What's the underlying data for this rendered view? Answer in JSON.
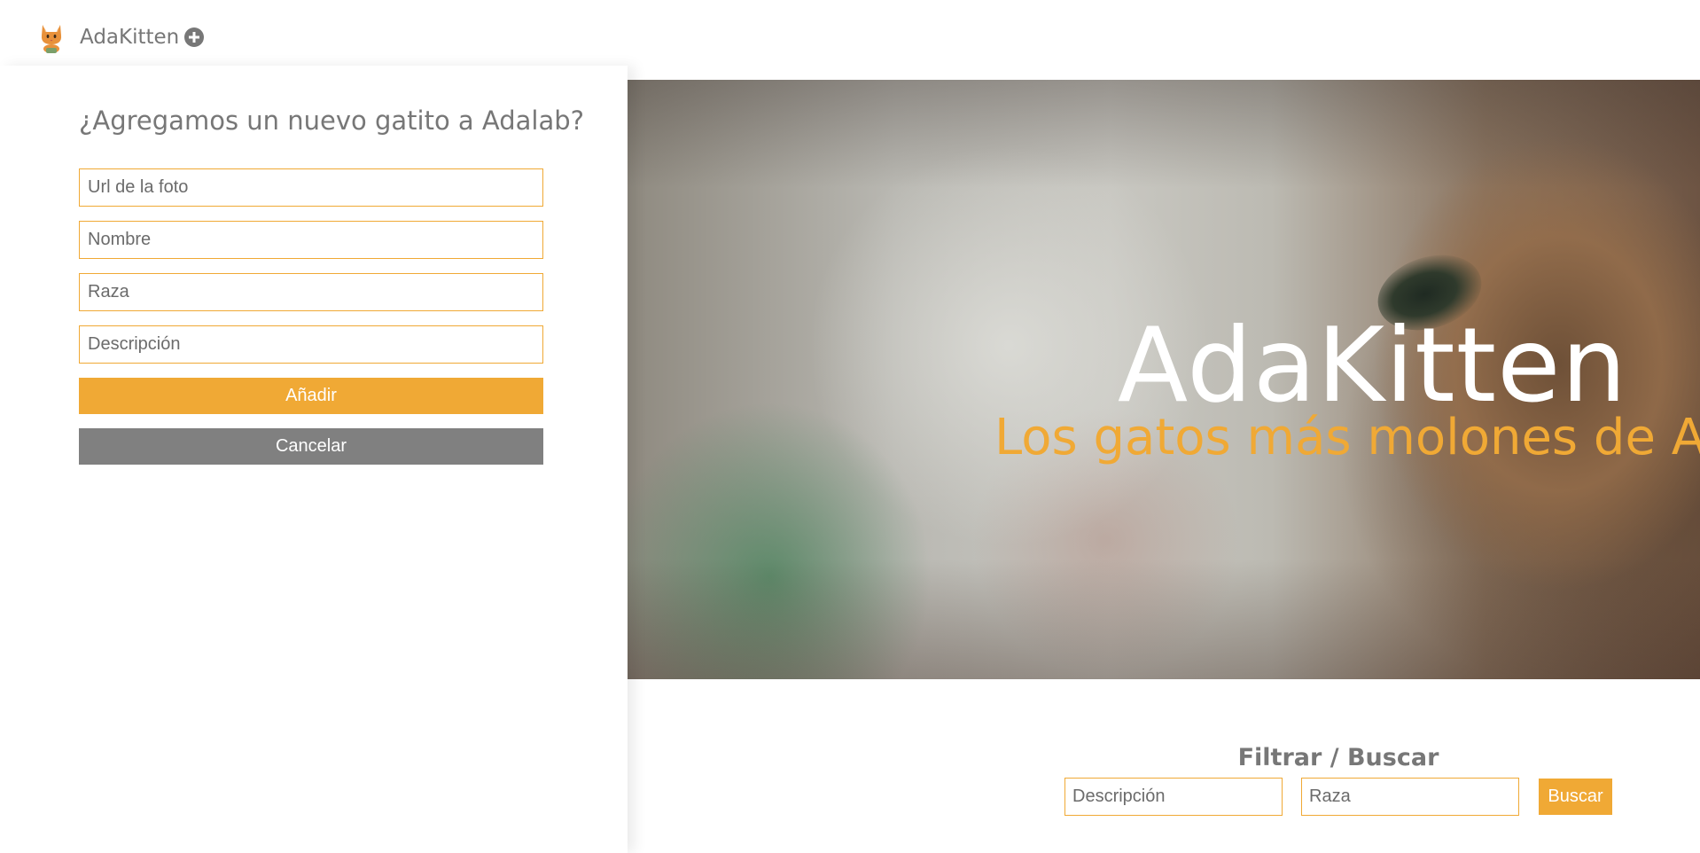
{
  "header": {
    "brand": "AdaKitten",
    "logo_icon": "cat-icon",
    "add_icon": "plus-circle-icon"
  },
  "new_form": {
    "title": "¿Agregamos un nuevo gatito a Adalab?",
    "fields": {
      "photo_url_placeholder": "Url de la foto",
      "name_placeholder": "Nombre",
      "breed_placeholder": "Raza",
      "description_placeholder": "Descripción"
    },
    "add_label": "Añadir",
    "cancel_label": "Cancelar"
  },
  "hero": {
    "title": "AdaKitten",
    "subtitle": "Los gatos más molones de Adalab"
  },
  "filter": {
    "title": "Filtrar / Buscar",
    "description_placeholder": "Descripción",
    "breed_placeholder": "Raza",
    "search_label": "Buscar"
  },
  "colors": {
    "accent": "#f0a935",
    "cancel": "#808080",
    "text": "#777777"
  }
}
